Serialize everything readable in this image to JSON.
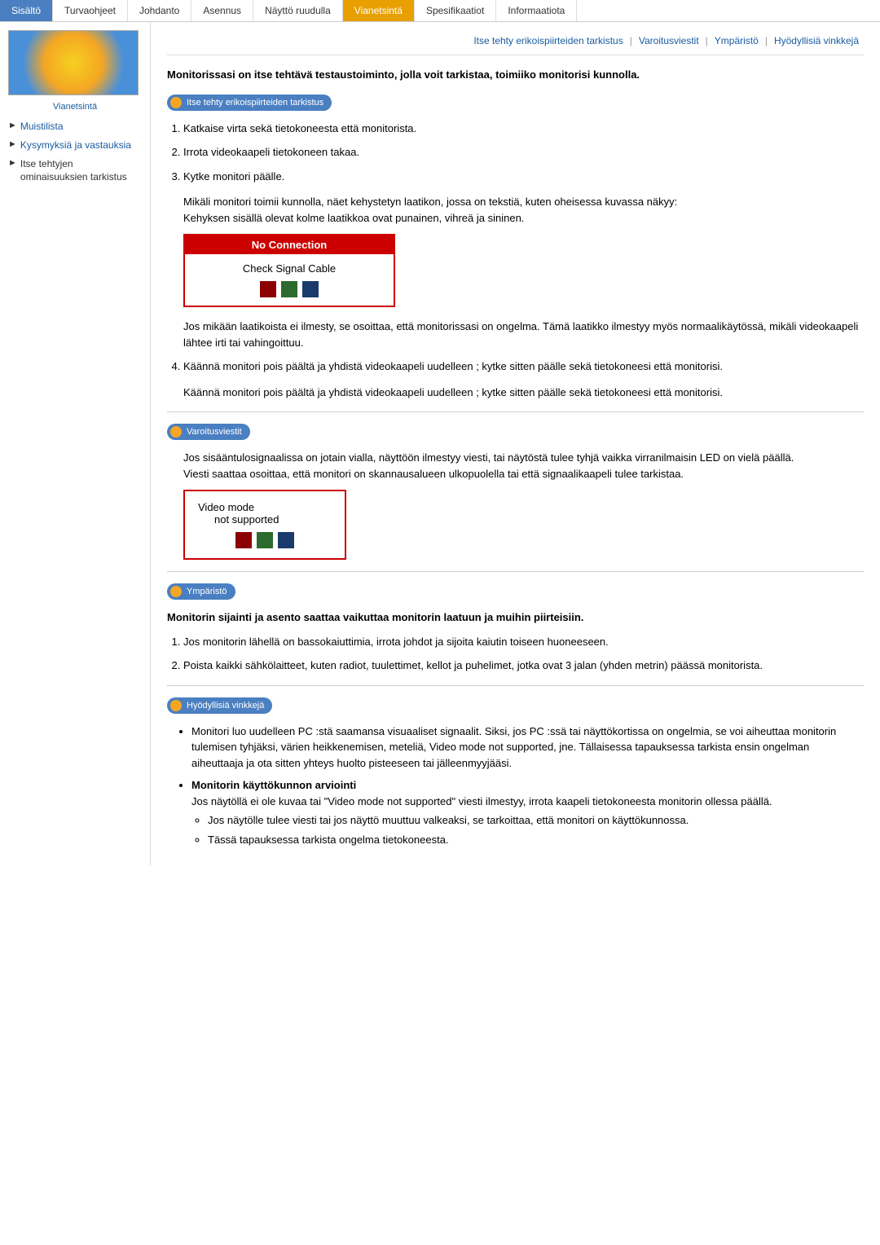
{
  "nav": {
    "items": [
      {
        "label": "Sisältö",
        "state": "active"
      },
      {
        "label": "Turvaohjeet",
        "state": "normal"
      },
      {
        "label": "Johdanto",
        "state": "normal"
      },
      {
        "label": "Asennus",
        "state": "normal"
      },
      {
        "label": "Näyttö ruudulla",
        "state": "normal"
      },
      {
        "label": "Vianetsintä",
        "state": "highlighted"
      },
      {
        "label": "Spesifikaatiot",
        "state": "normal"
      },
      {
        "label": "Informaatiota",
        "state": "normal"
      }
    ]
  },
  "secondary_nav": {
    "links": [
      "Itse tehty erikoispiirteiden tarkistus",
      "Varoitusviestit",
      "Ympäristö",
      "Hyödyllisiä vinkkejä"
    ]
  },
  "sidebar": {
    "label": "Vianetsintä",
    "links": [
      {
        "text": "Muistilista",
        "active": false
      },
      {
        "text": "Kysymyksiä ja vastauksia",
        "active": false
      },
      {
        "text": "Itse tehtyjen ominaisuuksien tarkistus",
        "active": true
      }
    ]
  },
  "intro_text": "Monitorissasi on itse tehtävä testaustoiminto, jolla voit tarkistaa, toimiiko monitorisi kunnolla.",
  "section1": {
    "header": "Itse tehty erikoispiirteiden tarkistus",
    "steps": [
      "Katkaise virta sekä tietokoneesta että monitorista.",
      "Irrota videokaapeli tietokoneen takaa.",
      "Kytke monitori päälle."
    ],
    "note1": "Mikäli monitori toimii kunnolla, näet kehystetyn laatikon, jossa on tekstiä, kuten oheisessa kuvassa näkyy:\nKehyksen sisällä olevat kolme laatikkoa ovat punainen, vihreä ja sininen.",
    "no_connection_label": "No Connection",
    "check_signal_label": "Check Signal Cable",
    "note2": "Jos mikään laatikoista ei ilmesty, se osoittaa, että monitorissasi on ongelma. Tämä laatikko ilmestyy myös normaalikäytössä, mikäli videokaapeli lähtee irti tai vahingoittuu.",
    "step4": "Käännä monitori pois päältä ja yhdistä videokaapeli uudelleen ; kytke sitten päälle sekä tietokoneesi että monitorisi.",
    "step4_repeat": "Käännä monitori pois päältä ja yhdistä videokaapeli uudelleen ; kytke sitten päälle sekä tietokoneesi että monitorisi."
  },
  "section2": {
    "header": "Varoitusviestit",
    "text1": "Jos sisääntulosignaalissa on jotain vialla, näyttöön ilmestyy viesti, tai näytöstä tulee tyhjä vaikka virranilmaisin LED on vielä päällä.\nViesti saattaa osoittaa, että monitori on skannausalueen ulkopuolella tai että signaalikaapeli tulee tarkistaa.",
    "video_mode_line1": "Video mode",
    "video_mode_line2": "not supported"
  },
  "section3": {
    "header": "Ympäristö",
    "intro_bold": "Monitorin sijainti ja asento saattaa vaikuttaa monitorin laatuun ja muihin piirteisiin.",
    "items": [
      "Jos monitorin lähellä on bassokaiuttimia, irrota johdot ja sijoita kaiutin toiseen huoneeseen.",
      "Poista kaikki sähkölaitteet, kuten radiot, tuulettimet, kellot ja puhelimet, jotka ovat 3 jalan (yhden metrin) päässä monitorista."
    ]
  },
  "section4": {
    "header": "Hyödyllisiä vinkkejä",
    "bullets": [
      "Monitori luo uudelleen PC :stä saamansa visuaaliset signaalit. Siksi, jos PC :ssä tai näyttökortissa on ongelmia, se voi aiheuttaa monitorin tulemisen tyhjäksi, värien heikkenemisen, meteliä, Video mode not supported, jne. Tällaisessa tapauksessa tarkista ensin ongelman aiheuttaaja ja ota sitten yhteys huolto pisteeseen tai jälleenmyyjääsi.",
      {
        "bold_title": "Monitorin käyttökunnon arviointi",
        "text": "Jos näytöllä ei ole kuvaa tai \"Video mode not supported\" viesti ilmestyy, irrota kaapeli tietokoneesta monitorin ollessa päällä.",
        "sub_items": [
          "Jos näytölle tulee viesti tai jos näyttö muuttuu valkeaksi, se tarkoittaa, että monitori on käyttökunnossa.",
          "Tässä tapauksessa tarkista ongelma tietokoneesta."
        ]
      }
    ]
  }
}
